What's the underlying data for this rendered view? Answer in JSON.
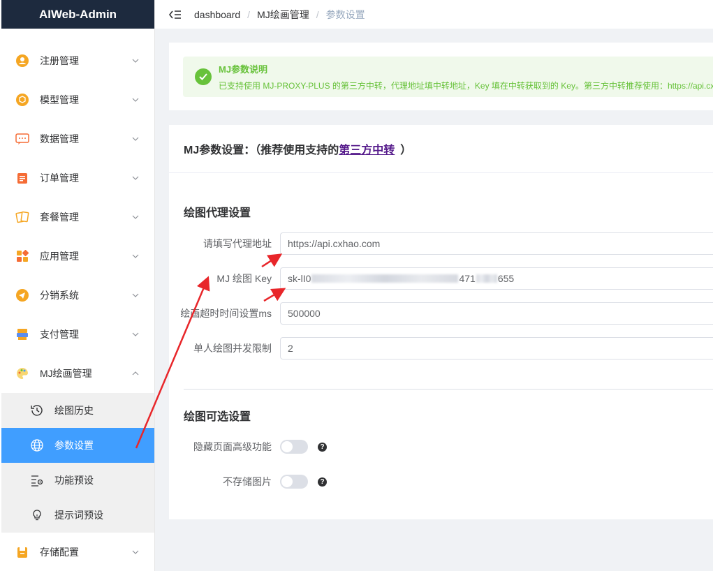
{
  "app": {
    "title": "AIWeb-Admin"
  },
  "sidebar": {
    "items": [
      {
        "label": "注册管理",
        "icon": "user-circle-icon",
        "color": "#f5a623"
      },
      {
        "label": "模型管理",
        "icon": "cube-icon",
        "color": "#f5a623"
      },
      {
        "label": "数据管理",
        "icon": "chat-icon",
        "color": "#f56c35"
      },
      {
        "label": "订单管理",
        "icon": "clipboard-icon",
        "color": "#f56c35"
      },
      {
        "label": "套餐管理",
        "icon": "cards-icon",
        "color": "#f5a623"
      },
      {
        "label": "应用管理",
        "icon": "apps-icon",
        "color": "#f5a623"
      },
      {
        "label": "分销系统",
        "icon": "send-icon",
        "color": "#f5a623"
      },
      {
        "label": "支付管理",
        "icon": "pos-icon",
        "color": "#f5a623"
      },
      {
        "label": "MJ绘画管理",
        "icon": "palette-icon",
        "color": "#f5a623"
      }
    ],
    "submenu": [
      {
        "label": "绘图历史",
        "icon": "history-icon"
      },
      {
        "label": "参数设置",
        "icon": "globe-icon"
      },
      {
        "label": "功能预设",
        "icon": "preset-icon"
      },
      {
        "label": "提示词预设",
        "icon": "bulb-icon"
      }
    ],
    "bottom_item": {
      "label": "存储配置",
      "icon": "storage-icon",
      "color": "#f5a623"
    }
  },
  "breadcrumb": [
    "dashboard",
    "MJ绘画管理",
    "参数设置"
  ],
  "alert": {
    "title": "MJ参数说明",
    "desc": "已支持使用 MJ-PROXY-PLUS 的第三方中转，代理地址填中转地址，Key 填在中转获取到的 Key。第三方中转推荐使用：https://api.cxhao.com"
  },
  "card": {
    "header_prefix": "MJ参数设置：（推荐使用支持的",
    "header_link": "第三方中转",
    "header_suffix": "）",
    "section1": "绘图代理设置",
    "fields": [
      {
        "label": "请填写代理地址",
        "value": "https://api.cxhao.com"
      },
      {
        "label": "MJ 绘图 Key",
        "value_prefix": "sk-lI0",
        "value_mid": "471",
        "value_suffix": "655"
      },
      {
        "label": "绘画超时时间设置ms",
        "value": "500000"
      },
      {
        "label": "单人绘图并发限制",
        "value": "2"
      }
    ],
    "section2": "绘图可选设置",
    "switches": [
      {
        "label": "隐藏页面高级功能",
        "on": false
      },
      {
        "label": "不存储图片",
        "on": false
      }
    ]
  },
  "colors": {
    "primary": "#409eff",
    "success": "#67c23a",
    "annotation": "#e8262a"
  }
}
